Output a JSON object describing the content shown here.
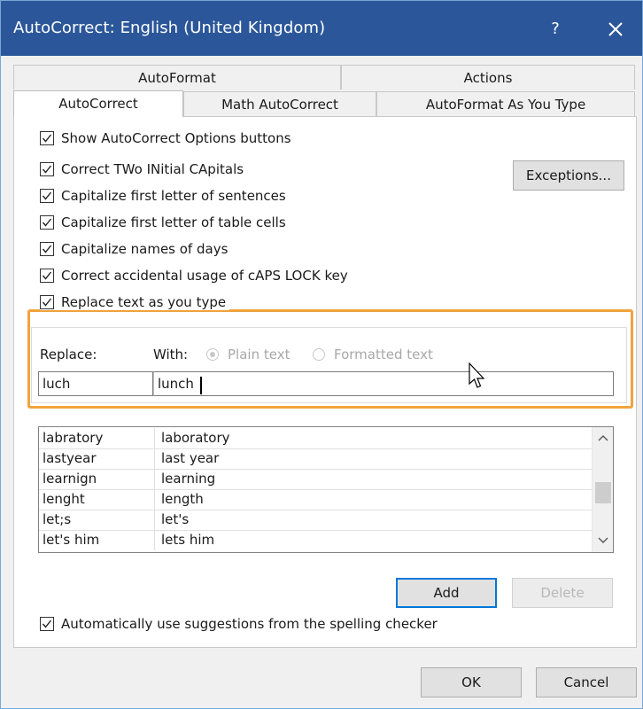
{
  "window": {
    "title": "AutoCorrect: English (United Kingdom)",
    "help_label": "?",
    "close_label": "✕"
  },
  "tabs": {
    "row1": [
      "AutoFormat",
      "Actions"
    ],
    "row2": [
      "AutoCorrect",
      "Math AutoCorrect",
      "AutoFormat As You Type"
    ],
    "active": "AutoCorrect"
  },
  "options": {
    "show_buttons": {
      "label": "Show AutoCorrect Options buttons",
      "checked": true
    },
    "correct_two_initial": {
      "label": "Correct TWo INitial CApitals",
      "checked": true
    },
    "cap_first_sentence": {
      "label": "Capitalize first letter of sentences",
      "checked": true
    },
    "cap_first_table": {
      "label": "Capitalize first letter of table cells",
      "checked": true
    },
    "cap_days": {
      "label": "Capitalize names of days",
      "checked": true
    },
    "caps_lock": {
      "label": "Correct accidental usage of cAPS LOCK key",
      "checked": true
    },
    "replace_text": {
      "label": "Replace text as you type",
      "checked": true
    },
    "auto_suggest": {
      "label": "Automatically use suggestions from the spelling checker",
      "checked": true
    }
  },
  "buttons": {
    "exceptions": "Exceptions...",
    "add": "Add",
    "delete": "Delete",
    "ok": "OK",
    "cancel": "Cancel"
  },
  "replace": {
    "replace_label": "Replace:",
    "with_label": "With:",
    "plain_text_label": "Plain text",
    "formatted_text_label": "Formatted text",
    "replace_value": "luch",
    "with_value": "lunch",
    "selected_format": "Plain text"
  },
  "entries": [
    {
      "replace": "labratory",
      "with": "laboratory"
    },
    {
      "replace": "lastyear",
      "with": "last year"
    },
    {
      "replace": "learnign",
      "with": "learning"
    },
    {
      "replace": "lenght",
      "with": "length"
    },
    {
      "replace": "let;s",
      "with": "let's"
    },
    {
      "replace": "let's him",
      "with": "lets him"
    }
  ],
  "colors": {
    "titlebar": "#2b579a",
    "highlight_border": "#f0a33c",
    "default_button_border": "#0078d7"
  }
}
